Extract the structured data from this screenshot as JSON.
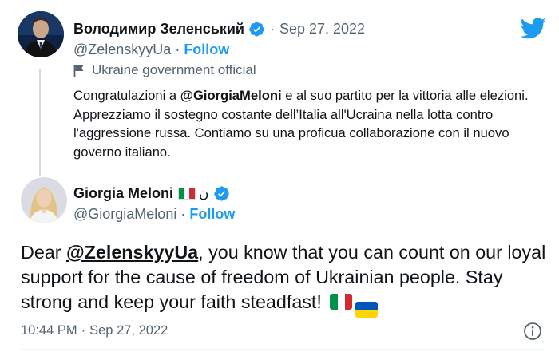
{
  "brand": {
    "logo_icon": "twitter-bird-icon",
    "accent": "#1d9bf0",
    "verified_color": "#1d9bf0"
  },
  "parent_tweet": {
    "author_name": "Володимир Зеленський",
    "verified_icon": "verified-badge-icon",
    "separator": "·",
    "date": "Sep 27, 2022",
    "handle": "@ZelenskyyUa",
    "handle_separator": "·",
    "follow_label": "Follow",
    "label_icon": "flag-icon",
    "label_text": "Ukraine government official",
    "text_before_mention": "Congratulazioni a ",
    "mention": "@GiorgiaMeloni",
    "text_after_mention": " e al suo partito per la vittoria alle elezioni. Apprezziamo il sostegno costante dell’Italia all'Ucraina nella lotta contro l'aggressione russa. Contiamo su una proficua collaborazione con il nuovo governo italiano."
  },
  "main_tweet": {
    "author_name": "Giorgia Meloni",
    "name_flag_icon": "italy-flag-icon",
    "name_extra": "ن",
    "verified_icon": "verified-badge-icon",
    "handle": "@GiorgiaMeloni",
    "handle_separator": "·",
    "follow_label": "Follow",
    "text_before_mention": "Dear ",
    "mention": "@ZelenskyyUa",
    "text_after_mention": ", you know that you can count on our loyal support for the cause of freedom of Ukrainian people. Stay strong and keep your faith steadfast!",
    "end_flags": [
      "italy-flag-icon",
      "ukraine-flag-icon"
    ],
    "time": "10:44 PM",
    "time_separator": "·",
    "date": "Sep 27, 2022",
    "info_icon": "info-icon"
  }
}
